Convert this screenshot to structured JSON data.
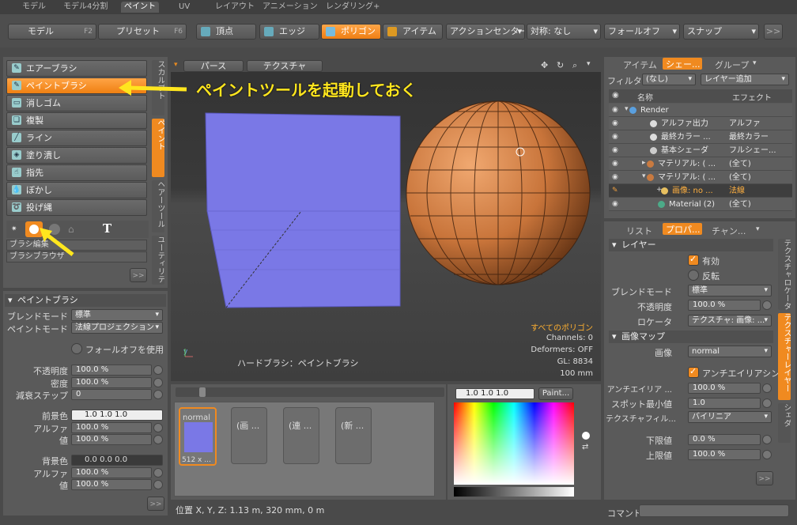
{
  "top_tabs": [
    "モデル",
    "モデル4分割",
    "ペイント",
    "UV",
    "レイアウト",
    "アニメーション",
    "レンダリング",
    "+"
  ],
  "active_top_tab": "ペイント",
  "toolbar": {
    "model": "モデル",
    "model_key": "F2",
    "preset": "プリセット",
    "preset_key": "F6",
    "vertex": "頂点",
    "edge": "エッジ",
    "polygon": "ポリゴン",
    "item": "アイテム",
    "action_center": "アクションセンター",
    "symmetry": "対称: なし",
    "falloff": "フォールオフ",
    "snap": "スナップ",
    "more": ">>"
  },
  "tools": [
    {
      "label": "エアーブラシ",
      "icon": "airbrush-icon",
      "glyph": "✎"
    },
    {
      "label": "ペイントブラシ",
      "icon": "paintbrush-icon",
      "glyph": "✎",
      "active": true
    },
    {
      "label": "消しゴム",
      "icon": "eraser-icon",
      "glyph": "▭"
    },
    {
      "label": "複製",
      "icon": "clone-icon",
      "glyph": "❏"
    },
    {
      "label": "ライン",
      "icon": "line-icon",
      "glyph": "╱"
    },
    {
      "label": "塗り潰し",
      "icon": "fill-icon",
      "glyph": "◈"
    },
    {
      "label": "指先",
      "icon": "smudge-icon",
      "glyph": "☝"
    },
    {
      "label": "ぼかし",
      "icon": "blur-icon",
      "glyph": "💧"
    },
    {
      "label": "投げ縄",
      "icon": "lasso-icon",
      "glyph": "➰"
    }
  ],
  "vertical_tabs": [
    "スカルプト",
    "ペイント",
    "ヘアーツール",
    "ユーティリティ"
  ],
  "brush_links": [
    "ブラシ編集",
    "ブラシブラウザ"
  ],
  "brush_text_glyph": "T",
  "expand_btn": ">>",
  "annotation": "ペイントツールを起動しておく",
  "paintbrush_props": {
    "header": "ペイントブラシ",
    "blend_label": "ブレンドモード",
    "blend_value": "標準",
    "mode_label": "ペイントモード",
    "mode_value": "法線プロジェクション",
    "falloff_label": "フォールオフを使用",
    "opacity_label": "不透明度",
    "opacity_value": "100.0 %",
    "density_label": "密度",
    "density_value": "100.0 %",
    "steps_label": "減衰ステップ",
    "steps_value": "0",
    "fg_label": "前景色",
    "fg_value": "1.0    1.0    1.0",
    "fg_alpha_label": "アルファ",
    "fg_alpha_value": "100.0 %",
    "fg_val_label": "値",
    "fg_val_value": "100.0 %",
    "bg_label": "背景色",
    "bg_value": "0.0    0.0    0.0",
    "bg_alpha_label": "アルファ",
    "bg_alpha_value": "100.0 %",
    "bg_val_label": "値",
    "bg_val_value": "100.0 %"
  },
  "viewport": {
    "tab_perspective": "パース",
    "tab_texture": "テクスチャ",
    "info_title": "すべてのポリゴン",
    "info_lines": [
      "Channels: 0",
      "Deformers: OFF",
      "GL: 8834",
      "100 mm"
    ],
    "brush_status": "ハードブラシ：ペイントブラシ"
  },
  "image_strip": [
    {
      "label": "normal",
      "sub": "512 x ..."
    },
    {
      "label": "(画 ..."
    },
    {
      "label": "(連 ..."
    },
    {
      "label": "(新 ..."
    }
  ],
  "color_picker": {
    "value": "1.0   1.0   1.0",
    "paint_button": "Paint..."
  },
  "status_bar": "位置 X, Y, Z:  1.13 m, 320 mm, 0 m",
  "right_tabs": [
    "アイテム",
    "シェー...",
    "グループ"
  ],
  "right_active_tab": "シェー...",
  "filter": {
    "label": "フィルター",
    "value": "(なし)",
    "add_layer": "レイヤー追加"
  },
  "shader_cols": [
    "名称",
    "エフェクト"
  ],
  "shader_rows": [
    {
      "name": "Render",
      "effect": ""
    },
    {
      "name": "アルファ出力",
      "effect": "アルファ"
    },
    {
      "name": "最終カラー ...",
      "effect": "最終カラー"
    },
    {
      "name": "基本シェーダ",
      "effect": "フルシェー..."
    },
    {
      "name": "マテリアル: ( ...",
      "effect": "(全て)"
    },
    {
      "name": "マテリアル: ( ...",
      "effect": "(全て)"
    },
    {
      "name": "画像: no ...",
      "effect": "法線",
      "selected": true
    },
    {
      "name": "Material (2)",
      "effect": "(全て)"
    }
  ],
  "prop_tabs": [
    "リスト",
    "プロパ...",
    "チャン..."
  ],
  "prop_active_tab": "プロパ...",
  "props": {
    "layer_header": "レイヤー",
    "enable_label": "有効",
    "invert_label": "反転",
    "blend_label": "ブレンドモード",
    "blend_value": "標準",
    "opacity_label": "不透明度",
    "opacity_value": "100.0 %",
    "locator_label": "ロケータ",
    "locator_value": "テクスチャ: 画像: ...",
    "image_map_header": "画像マップ",
    "image_label": "画像",
    "image_value": "normal",
    "antialias_label": "アンチエイリアシング",
    "aa_label": "アンチエイリア ...",
    "aa_value": "100.0 %",
    "spot_label": "スポット最小値",
    "spot_value": "1.0",
    "filter_label": "テクスチャフィル...",
    "filter_value": "バイリニア",
    "low_label": "下限値",
    "low_value": "0.0 %",
    "high_label": "上限値",
    "high_value": "100.0 %"
  },
  "right_vtabs": [
    "テクスチャロケータ",
    "テクスチャーレイヤー",
    "シェダ"
  ],
  "command_label": "コマンド",
  "colors": {
    "accent": "#f08a20",
    "plane": "#7a78e6",
    "sphere": "#c87a40",
    "annotation": "#ffe61e"
  }
}
